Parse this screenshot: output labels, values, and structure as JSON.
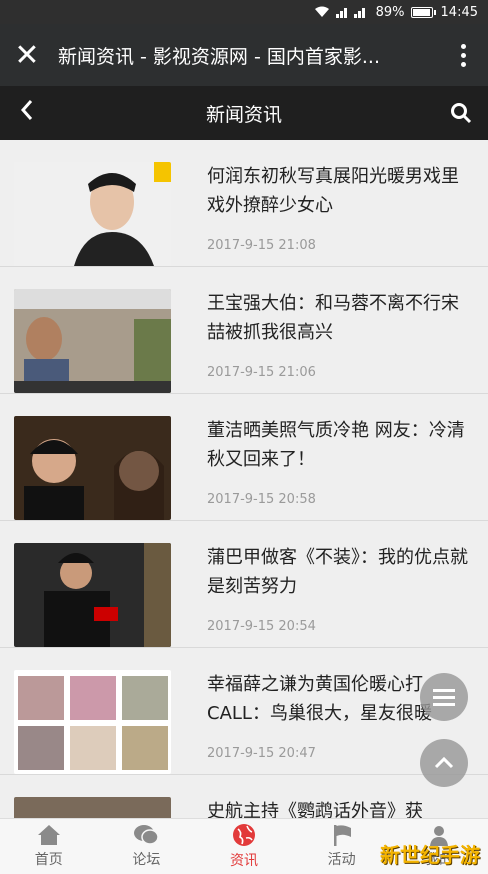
{
  "status": {
    "signal": "▮▮▮ ▮▮▮",
    "battery": "89%",
    "battery_level": 0.89,
    "time": "14:45"
  },
  "appbar": {
    "title": "新闻资讯 - 影视资源网 - 国内首家影..."
  },
  "navbar": {
    "title": "新闻资讯"
  },
  "articles": [
    {
      "title": "何润东初秋写真展阳光暖男戏里戏外撩醉少女心",
      "date": "2017-9-15 21:08"
    },
    {
      "title": "王宝强大伯：和马蓉不离不行宋喆被抓我很高兴",
      "date": "2017-9-15 21:06"
    },
    {
      "title": "董洁晒美照气质冷艳 网友：冷清秋又回来了！",
      "date": "2017-9-15 20:58"
    },
    {
      "title": "蒲巴甲做客《不装》：我的优点就是刻苦努力",
      "date": "2017-9-15 20:54"
    },
    {
      "title": "幸福薛之谦为黄国伦暖心打CALL：鸟巢很大，星友很暖",
      "date": "2017-9-15 20:47"
    },
    {
      "title": "史航主持《鹦鹉话外音》获",
      "date": ""
    }
  ],
  "tabs": [
    {
      "label": "首页",
      "icon": "home-icon"
    },
    {
      "label": "论坛",
      "icon": "chat-icon"
    },
    {
      "label": "资讯",
      "icon": "globe-icon",
      "active": true
    },
    {
      "label": "活动",
      "icon": "flag-icon"
    },
    {
      "label": "我的",
      "icon": "user-icon"
    }
  ],
  "watermark": "新世纪手游",
  "colors": {
    "accent": "#e23a3a",
    "appbar": "#2d2f30",
    "navbar": "#1f1f1f"
  }
}
